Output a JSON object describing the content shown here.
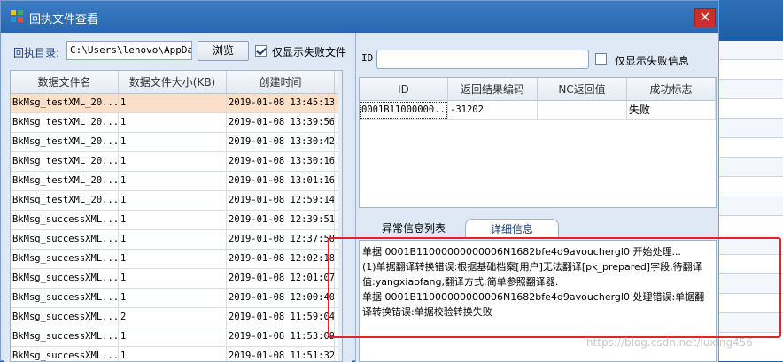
{
  "window": {
    "title": "回执文件查看",
    "close_label": "×"
  },
  "left": {
    "dir_label": "回执目录:",
    "dir_value": "C:\\Users\\lenovo\\AppDat",
    "browse_label": "浏览",
    "only_failed_label": "仅显示失败文件",
    "only_failed_checked": true,
    "columns": [
      "数据文件名",
      "数据文件大小(KB)",
      "创建时间"
    ],
    "rows": [
      [
        "BkMsg_testXML_20...",
        "1",
        "2019-01-08 13:45:13"
      ],
      [
        "BkMsg_testXML_20...",
        "1",
        "2019-01-08 13:39:56"
      ],
      [
        "BkMsg_testXML_20...",
        "1",
        "2019-01-08 13:30:42"
      ],
      [
        "BkMsg_testXML_20...",
        "1",
        "2019-01-08 13:30:16"
      ],
      [
        "BkMsg_testXML_20...",
        "1",
        "2019-01-08 13:01:16"
      ],
      [
        "BkMsg_testXML_20...",
        "1",
        "2019-01-08 12:59:14"
      ],
      [
        "BkMsg_successXML...",
        "1",
        "2019-01-08 12:39:51"
      ],
      [
        "BkMsg_successXML...",
        "1",
        "2019-01-08 12:37:58"
      ],
      [
        "BkMsg_successXML...",
        "1",
        "2019-01-08 12:02:18"
      ],
      [
        "BkMsg_successXML...",
        "1",
        "2019-01-08 12:01:07"
      ],
      [
        "BkMsg_successXML...",
        "1",
        "2019-01-08 12:00:40"
      ],
      [
        "BkMsg_successXML...",
        "2",
        "2019-01-08 11:59:04"
      ],
      [
        "BkMsg_successXML...",
        "1",
        "2019-01-08 11:53:09"
      ],
      [
        "BkMsg_successXML...",
        "1",
        "2019-01-08 11:51:32"
      ]
    ]
  },
  "right": {
    "id_label": "ID",
    "id_value": "",
    "only_failed_label": "仅显示失败信息",
    "only_failed_checked": false,
    "columns": [
      "ID",
      "返回结果编码",
      "NC返回值",
      "成功标志"
    ],
    "rows": [
      [
        "0001B11000000...",
        "-31202",
        "",
        "失败"
      ]
    ],
    "tabs": [
      "异常信息列表",
      "详细信息"
    ],
    "detail_lines": [
      "单据  0001B11000000000006N1682bfe4d9avouchergl0  开始处理...",
      "(1)单据翻译转换错误:根据基础档案[用户]无法翻译[pk_prepared]字段,待翻译值:yangxiaofang,翻译方式:简单参照翻译器.",
      "单据  0001B11000000000006N1682bfe4d9avouchergl0  处理错误:单据翻译转换错误:单据校验转换失败"
    ]
  },
  "watermark": "https://blog.csdn.net/luxing456",
  "colors": {
    "title_bar": "#2a67ad",
    "selected_row": "#fadfcb",
    "highlight_box": "#e3232b"
  }
}
